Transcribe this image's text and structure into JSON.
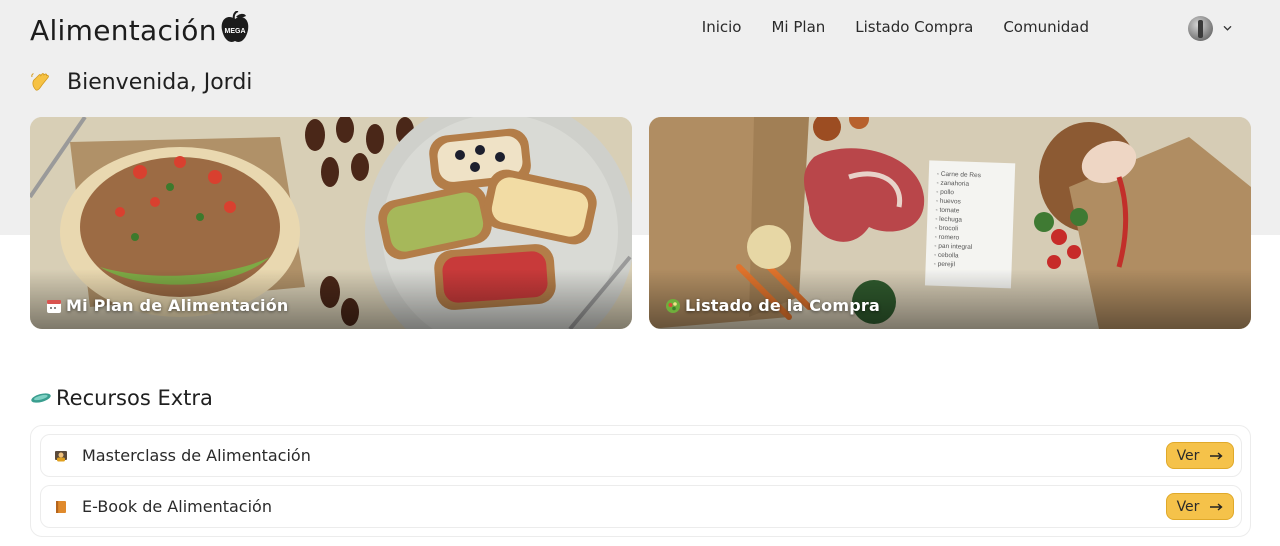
{
  "header": {
    "brand": "Alimentación",
    "logo_text": "MEGA",
    "nav": [
      "Inicio",
      "Mi Plan",
      "Listado Compra",
      "Comunidad"
    ],
    "user_avatar_icon": "avatar",
    "user_menu_icon": "chevron-down-icon"
  },
  "greeting": {
    "icon": "waving-hand-icon",
    "text": "Bienvenida, Jordi"
  },
  "cards": [
    {
      "label": "Mi Plan de Alimentación",
      "icon": "calendar-icon"
    },
    {
      "label": "Listado de la Compra",
      "icon": "salad-icon"
    }
  ],
  "shopping_list_note": [
    "Carne de Res",
    "zanahoria",
    "pollo",
    "huevos",
    "tomate",
    "lechuga",
    "brocoli",
    "romero",
    "pan integral",
    "cebolla",
    "perejil"
  ],
  "resources": {
    "title": "Recursos Extra",
    "title_icon": "flying-disc-icon",
    "items": [
      {
        "label": "Masterclass de Alimentación",
        "icon": "teacher-icon",
        "button": "Ver"
      },
      {
        "label": "E-Book de Alimentación",
        "icon": "book-icon",
        "button": "Ver"
      }
    ]
  },
  "colors": {
    "accent": "#f5c24a",
    "header_bg": "#efefef",
    "text": "#1f1f1f"
  }
}
